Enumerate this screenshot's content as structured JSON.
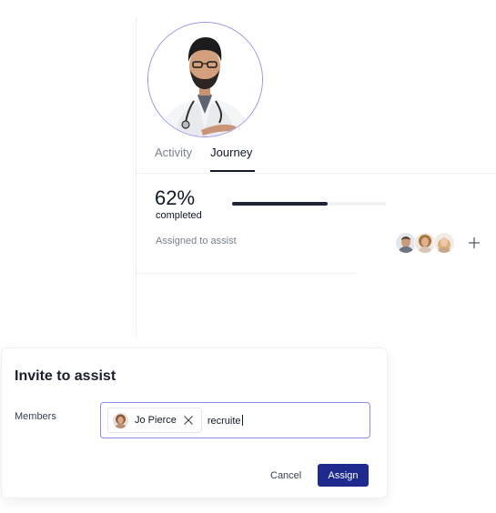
{
  "profile": {
    "avatar_icon": "doctor-portrait",
    "accent": "#9a92e6"
  },
  "tabs": [
    {
      "label": "Activity",
      "active": false
    },
    {
      "label": "Journey",
      "active": true
    }
  ],
  "progress": {
    "value_text": "62%",
    "label": "completed",
    "fraction": 0.62
  },
  "assist": {
    "label": "Assigned to assist",
    "assignee_icons": [
      "avatar-man",
      "avatar-woman-curly",
      "avatar-woman-blonde"
    ],
    "add_icon": "plus-icon"
  },
  "modal": {
    "title": "Invite to assist",
    "members_label": "Members",
    "chip": {
      "name": "Jo Pierce",
      "remove_icon": "close-icon"
    },
    "typed_value": "recruite",
    "cancel_label": "Cancel",
    "assign_label": "Assign",
    "primary_color": "#1f2a8f"
  }
}
